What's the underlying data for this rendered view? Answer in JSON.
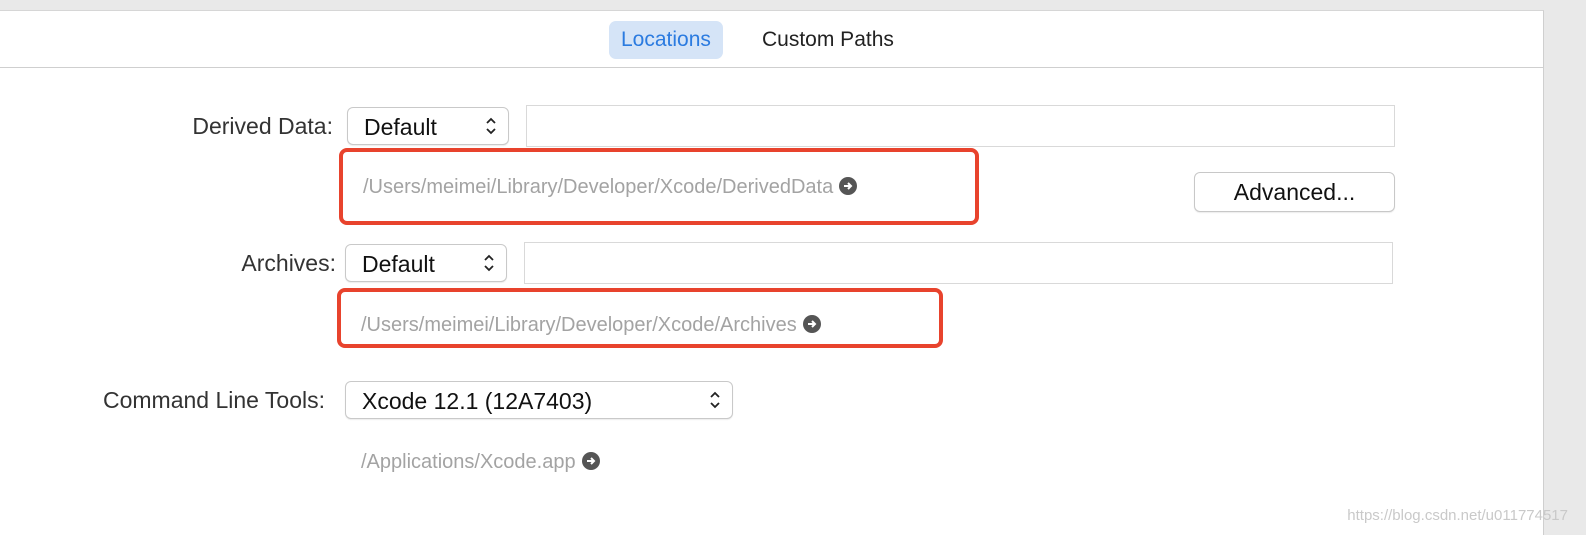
{
  "tabs": [
    {
      "label": "Locations",
      "active": true
    },
    {
      "label": "Custom Paths",
      "active": false
    }
  ],
  "derived_data": {
    "label": "Derived Data:",
    "selection": "Default",
    "path": "/Users/meimei/Library/Developer/Xcode/DerivedData",
    "advanced_button": "Advanced..."
  },
  "archives": {
    "label": "Archives:",
    "selection": "Default",
    "path": "/Users/meimei/Library/Developer/Xcode/Archives"
  },
  "command_line_tools": {
    "label": "Command Line Tools:",
    "selection": "Xcode 12.1 (12A7403)",
    "path": "/Applications/Xcode.app"
  },
  "watermark": "https://blog.csdn.net/u011774517",
  "colors": {
    "accent": "#2b7be0",
    "tab_active_bg": "#d5e4f7",
    "highlight_border": "#e8432d",
    "path_text": "#a3a3a3"
  },
  "icons": {
    "popup": "up-down-chevron-icon",
    "reveal": "arrow-circle-right-icon"
  }
}
